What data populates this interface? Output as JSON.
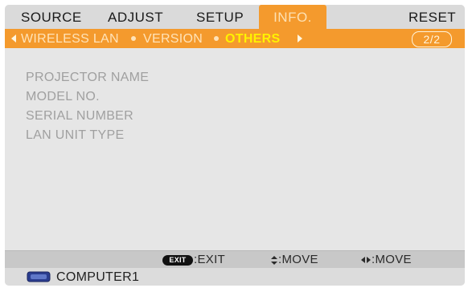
{
  "menu": {
    "tabs": [
      {
        "label": "SOURCE"
      },
      {
        "label": "ADJUST"
      },
      {
        "label": "SETUP"
      },
      {
        "label": "INFO."
      },
      {
        "label": "RESET"
      }
    ],
    "active_tab": "INFO."
  },
  "subtabs": {
    "items": [
      {
        "label": "WIRELESS LAN"
      },
      {
        "label": "VERSION"
      },
      {
        "label": "OTHERS"
      }
    ],
    "active": "OTHERS",
    "page_indicator": "2/2"
  },
  "content": {
    "rows": [
      {
        "label": "PROJECTOR NAME"
      },
      {
        "label": "MODEL NO."
      },
      {
        "label": "SERIAL NUMBER"
      },
      {
        "label": "LAN UNIT TYPE"
      }
    ]
  },
  "guide": {
    "exit_key": "EXIT",
    "exit_label": ":EXIT",
    "move_ud_label": ":MOVE",
    "move_lr_label": ":MOVE"
  },
  "source": {
    "label": "COMPUTER1",
    "icon": "computer-input-icon"
  },
  "colors": {
    "accent": "#f49a2d",
    "active_subtab": "#fff200",
    "panel": "#e6e6e6"
  }
}
